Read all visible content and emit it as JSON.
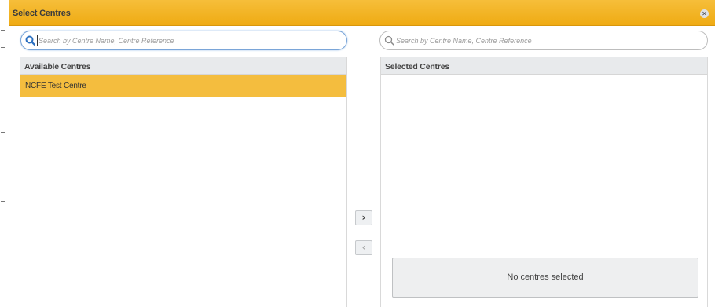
{
  "dialog": {
    "title": "Select Centres",
    "close_icon": "close-icon",
    "accent_color": "#f2b227"
  },
  "available": {
    "search_placeholder": "Search by Centre Name, Centre Reference",
    "header": "Available Centres",
    "items": [
      {
        "label": "NCFE Test Centre",
        "selected": true
      }
    ]
  },
  "selected": {
    "search_placeholder": "Search by Centre Name, Centre Reference",
    "header": "Selected Centres",
    "empty_message": "No centres selected"
  },
  "controls": {
    "add": {
      "symbol": "›",
      "icon": "chevron-right-icon"
    },
    "remove": {
      "symbol": "‹",
      "icon": "chevron-left-icon"
    }
  }
}
